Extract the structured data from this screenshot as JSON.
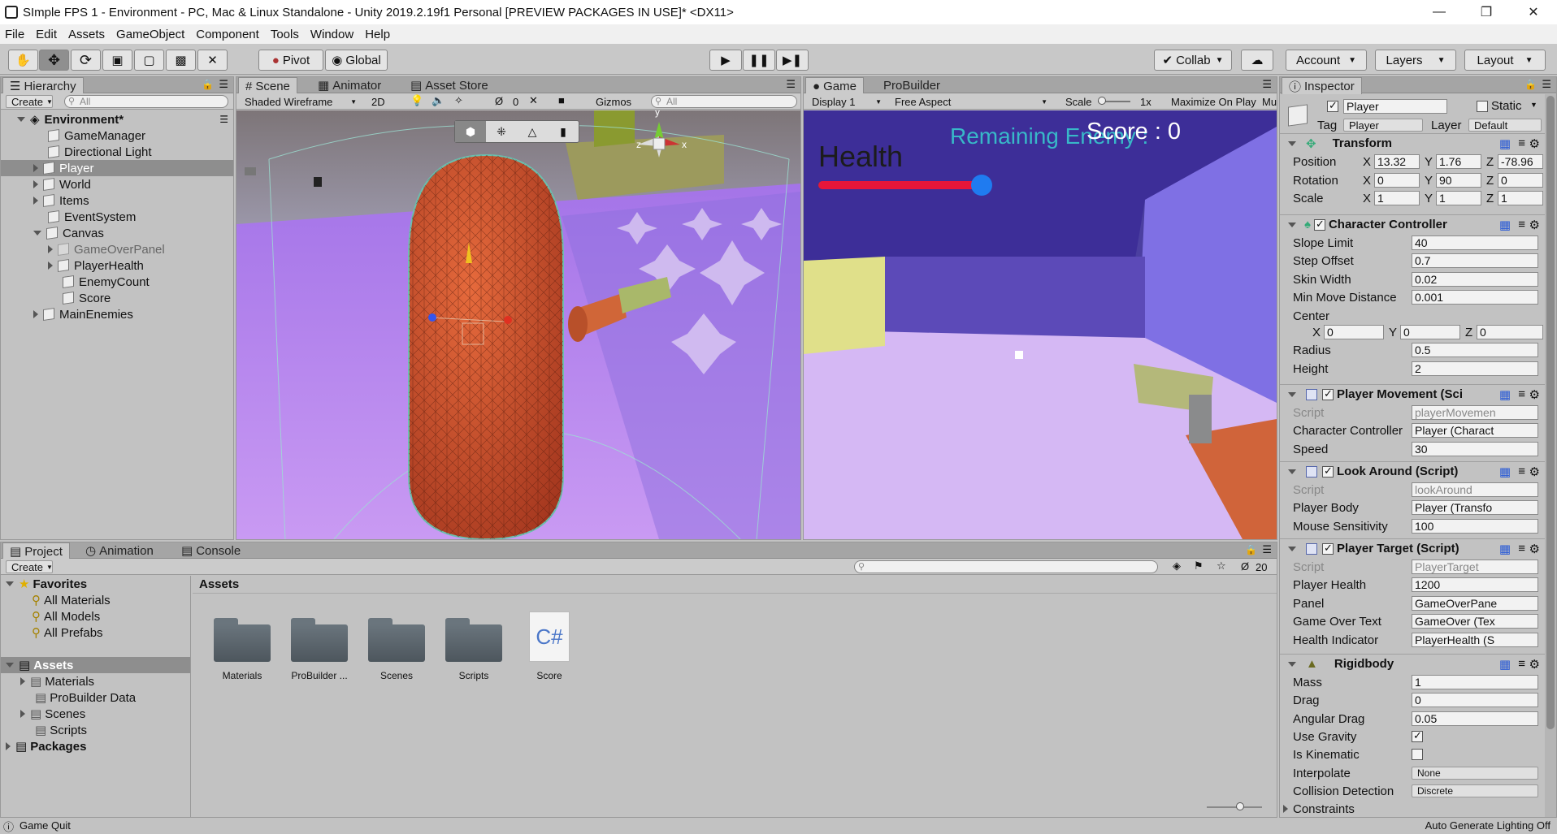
{
  "window": {
    "title": "SImple FPS 1 - Environment - PC, Mac & Linux Standalone - Unity 2019.2.19f1 Personal [PREVIEW PACKAGES IN USE]* <DX11>",
    "minimize": "—",
    "restore": "❐",
    "close": "✕"
  },
  "menu": [
    "File",
    "Edit",
    "Assets",
    "GameObject",
    "Component",
    "Tools",
    "Window",
    "Help"
  ],
  "toolbar": {
    "pivot": "Pivot",
    "global": "Global",
    "collab": "Collab",
    "account": "Account",
    "layers": "Layers",
    "layout": "Layout"
  },
  "hierarchy": {
    "tab": "Hierarchy",
    "create": "Create",
    "search_placeholder": "All",
    "scene": "Environment*",
    "items": [
      "GameManager",
      "Directional Light",
      "Player",
      "World",
      "Items",
      "EventSystem",
      "Canvas",
      "GameOverPanel",
      "PlayerHealth",
      "EnemyCount",
      "Score",
      "MainEnemies"
    ]
  },
  "scene": {
    "tabs": [
      "Scene",
      "Animator",
      "Asset Store"
    ],
    "shading": "Shaded Wireframe",
    "mode2d": "2D",
    "hidden_count": "0",
    "gizmos": "Gizmos",
    "search_placeholder": "All",
    "axis": {
      "y": "y",
      "x": "x",
      "z": "z"
    }
  },
  "game": {
    "tabs": [
      "Game",
      "ProBuilder"
    ],
    "display": "Display 1",
    "aspect": "Free Aspect",
    "scale_label": "Scale",
    "scale_value": "1x",
    "maximize": "Maximize On Play",
    "mute": "Mu",
    "hud": {
      "health": "Health",
      "remaining": "Remaining Enemy :",
      "score": "Score : 0"
    },
    "health_fraction": 0.98
  },
  "inspector": {
    "tab": "Inspector",
    "name": "Player",
    "static": "Static",
    "tag_label": "Tag",
    "tag": "Player",
    "layer_label": "Layer",
    "layer": "Default",
    "transform": {
      "title": "Transform",
      "position": {
        "label": "Position",
        "x": "13.32",
        "y": "1.76",
        "z": "-78.96"
      },
      "rotation": {
        "label": "Rotation",
        "x": "0",
        "y": "90",
        "z": "0"
      },
      "scale": {
        "label": "Scale",
        "x": "1",
        "y": "1",
        "z": "1"
      }
    },
    "character_controller": {
      "title": "Character Controller",
      "slope_limit": {
        "label": "Slope Limit",
        "value": "40"
      },
      "step_offset": {
        "label": "Step Offset",
        "value": "0.7"
      },
      "skin_width": {
        "label": "Skin Width",
        "value": "0.02"
      },
      "min_move": {
        "label": "Min Move Distance",
        "value": "0.001"
      },
      "center": {
        "label": "Center",
        "x": "0",
        "y": "0",
        "z": "0"
      },
      "radius": {
        "label": "Radius",
        "value": "0.5"
      },
      "height": {
        "label": "Height",
        "value": "2"
      }
    },
    "player_movement": {
      "title": "Player Movement (Sci",
      "script": {
        "label": "Script",
        "value": "playerMovemen"
      },
      "cc": {
        "label": "Character Controller",
        "value": "Player (Charact"
      },
      "speed": {
        "label": "Speed",
        "value": "30"
      }
    },
    "look_around": {
      "title": "Look Around (Script)",
      "script": {
        "label": "Script",
        "value": "lookAround"
      },
      "body": {
        "label": "Player Body",
        "value": "Player (Transfo"
      },
      "sens": {
        "label": "Mouse Sensitivity",
        "value": "100"
      }
    },
    "player_target": {
      "title": "Player Target (Script)",
      "script": {
        "label": "Script",
        "value": "PlayerTarget"
      },
      "health": {
        "label": "Player Health",
        "value": "1200"
      },
      "panel": {
        "label": "Panel",
        "value": "GameOverPane"
      },
      "gameover": {
        "label": "Game Over Text",
        "value": "GameOver (Tex"
      },
      "indicator": {
        "label": "Health Indicator",
        "value": "PlayerHealth (S"
      }
    },
    "rigidbody": {
      "title": "Rigidbody",
      "mass": {
        "label": "Mass",
        "value": "1"
      },
      "drag": {
        "label": "Drag",
        "value": "0"
      },
      "angular": {
        "label": "Angular Drag",
        "value": "0.05"
      },
      "gravity": {
        "label": "Use Gravity"
      },
      "kinematic": {
        "label": "Is Kinematic"
      },
      "interpolate": {
        "label": "Interpolate",
        "value": "None"
      },
      "collision": {
        "label": "Collision Detection",
        "value": "Discrete"
      },
      "constraints": {
        "label": "Constraints"
      }
    }
  },
  "project": {
    "tabs": [
      "Project",
      "Animation",
      "Console"
    ],
    "create": "Create",
    "count": "20",
    "favorites": {
      "title": "Favorites",
      "items": [
        "All Materials",
        "All Models",
        "All Prefabs"
      ]
    },
    "assets_root": "Assets",
    "tree": [
      "Materials",
      "ProBuilder Data",
      "Scenes",
      "Scripts"
    ],
    "packages": "Packages",
    "breadcrumb": "Assets",
    "assets": [
      "Materials",
      "ProBuilder ...",
      "Scenes",
      "Scripts",
      "Score"
    ],
    "cs_glyph": "C#"
  },
  "status": {
    "left": "Game Quit",
    "right": "Auto Generate Lighting Off"
  }
}
